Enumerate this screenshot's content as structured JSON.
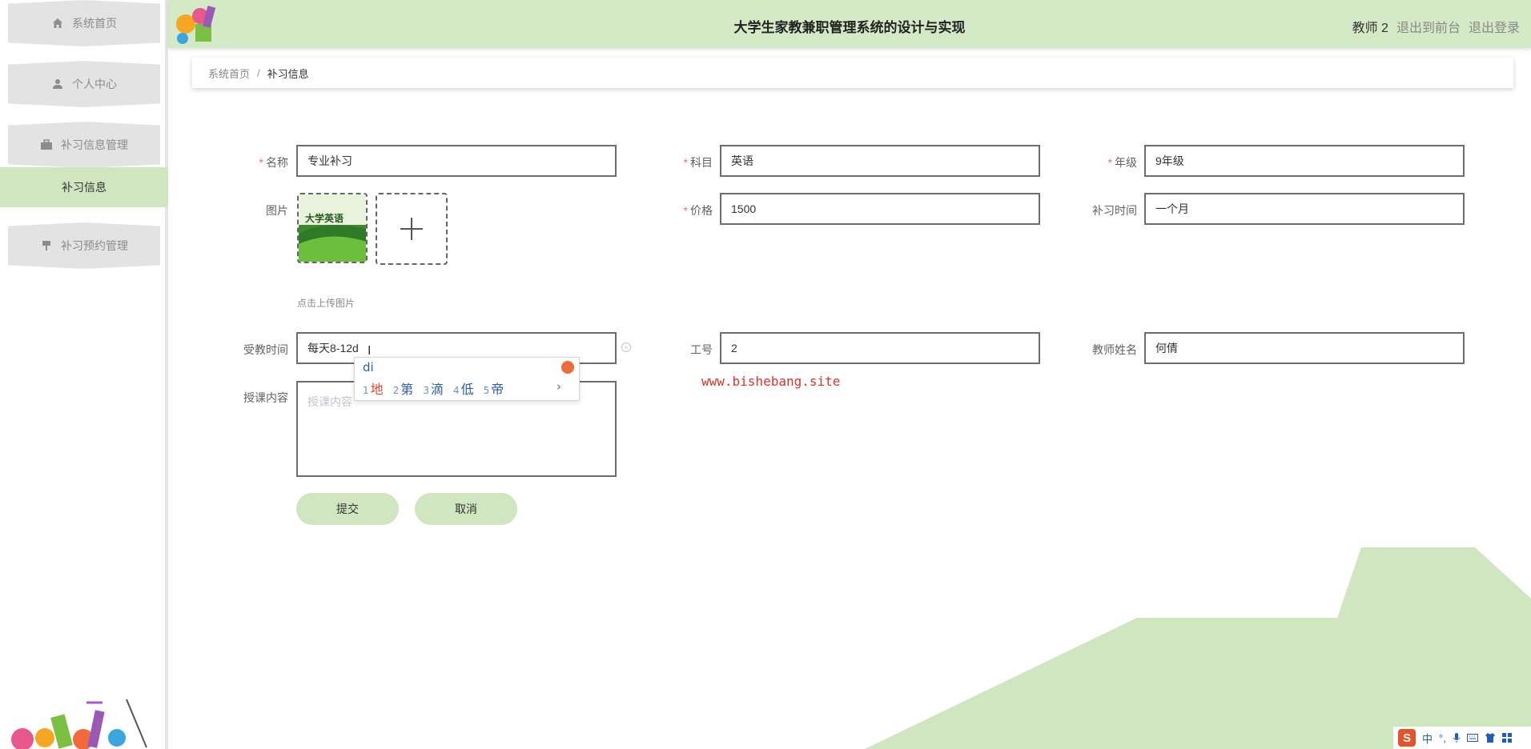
{
  "header": {
    "title": "大学生家教兼职管理系统的设计与实现",
    "user_name": "教师 2",
    "back_to_front": "退出到前台",
    "logout": "退出登录"
  },
  "sidebar": {
    "items": [
      {
        "label": "系统首页",
        "icon": "home-icon"
      },
      {
        "label": "个人中心",
        "icon": "user-icon"
      },
      {
        "label": "补习信息管理",
        "icon": "briefcase-icon"
      },
      {
        "label": "补习预约管理",
        "icon": "pin-icon"
      }
    ],
    "active_sub": "补习信息"
  },
  "breadcrumb": {
    "home": "系统首页",
    "separator": "/",
    "current": "补习信息"
  },
  "form": {
    "name_label": "名称",
    "name_value": "专业补习",
    "subject_label": "科目",
    "subject_value": "英语",
    "grade_label": "年级",
    "grade_value": "9年级",
    "image_label": "图片",
    "thumb_text": "大学英语",
    "upload_hint": "点击上传图片",
    "price_label": "价格",
    "price_value": "1500",
    "duration_label": "补习时间",
    "duration_value": "一个月",
    "teach_time_label": "受教时间",
    "teach_time_value": "每天8-12d",
    "job_no_label": "工号",
    "job_no_value": "2",
    "teacher_name_label": "教师姓名",
    "teacher_name_value": "何倩",
    "content_label": "授课内容",
    "content_placeholder": "授课内容",
    "required_mark": "*",
    "submit_label": "提交",
    "cancel_label": "取消"
  },
  "ime": {
    "pinyin": "di",
    "candidates": [
      {
        "n": "1",
        "text": "地"
      },
      {
        "n": "2",
        "text": "第"
      },
      {
        "n": "3",
        "text": "滴"
      },
      {
        "n": "4",
        "text": "低"
      },
      {
        "n": "5",
        "text": "帝"
      }
    ],
    "next": "›"
  },
  "watermark": "www.bishebang.site",
  "tray": {
    "logo": "S",
    "lang": "中"
  },
  "colors": {
    "accent_green": "#d4eac6",
    "button_green": "#cfe6c0",
    "required_red": "#f56c6c"
  }
}
